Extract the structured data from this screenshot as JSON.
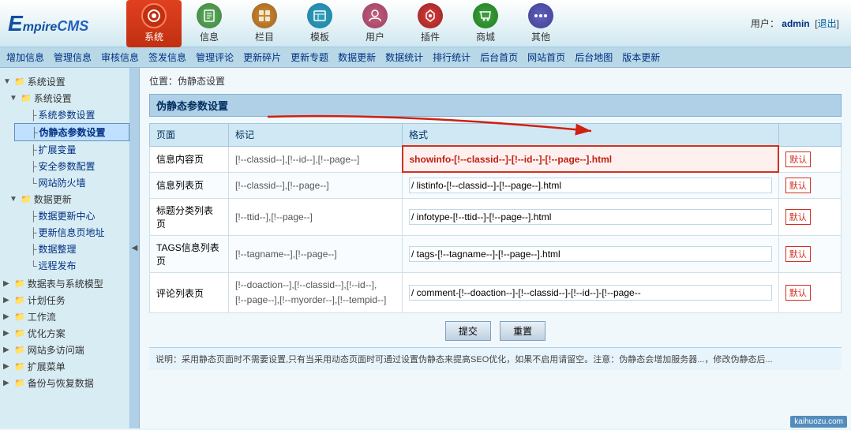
{
  "header": {
    "logo": "EmpireCMS",
    "user_label": "用户：",
    "user_name": "admin",
    "logout_label": "退出",
    "nav": [
      {
        "id": "sys",
        "label": "系统",
        "active": true
      },
      {
        "id": "info",
        "label": "信息",
        "active": false
      },
      {
        "id": "col",
        "label": "栏目",
        "active": false
      },
      {
        "id": "tpl",
        "label": "模板",
        "active": false
      },
      {
        "id": "user",
        "label": "用户",
        "active": false
      },
      {
        "id": "plugin",
        "label": "插件",
        "active": false
      },
      {
        "id": "shop",
        "label": "商城",
        "active": false
      },
      {
        "id": "other",
        "label": "其他",
        "active": false
      }
    ]
  },
  "toolbar": {
    "items": [
      "增加信息",
      "管理信息",
      "审核信息",
      "签发信息",
      "管理评论",
      "更新碎片",
      "更新专题",
      "数据更新",
      "数据统计",
      "排行统计",
      "后台首页",
      "网站首页",
      "后台地图",
      "版本更新"
    ]
  },
  "sidebar": {
    "title": "系统设置",
    "tree": [
      {
        "label": "系统设置",
        "type": "group",
        "children": [
          {
            "label": "系统参数设置",
            "active": false
          },
          {
            "label": "伪静态参数设置",
            "active": true
          },
          {
            "label": "扩展变量",
            "active": false
          },
          {
            "label": "安全参数配置",
            "active": false
          },
          {
            "label": "网站防火墙",
            "active": false
          }
        ]
      },
      {
        "label": "数据更新",
        "type": "group",
        "children": [
          {
            "label": "数据更新中心",
            "active": false
          },
          {
            "label": "更新信息页地址",
            "active": false
          },
          {
            "label": "数据整理",
            "active": false
          },
          {
            "label": "远程发布",
            "active": false
          }
        ]
      },
      {
        "label": "数据表与系统模型",
        "type": "group",
        "children": []
      },
      {
        "label": "计划任务",
        "type": "group",
        "children": []
      },
      {
        "label": "工作流",
        "type": "group",
        "children": []
      },
      {
        "label": "优化方案",
        "type": "group",
        "children": []
      },
      {
        "label": "网站多访问端",
        "type": "group",
        "children": []
      },
      {
        "label": "扩展菜单",
        "type": "group",
        "children": []
      },
      {
        "label": "备份与恢复数据",
        "type": "group",
        "children": []
      }
    ]
  },
  "content": {
    "breadcrumb": "位置：伪静态设置",
    "section_title": "伪静态参数设置",
    "table_headers": [
      "页面",
      "标记",
      "格式"
    ],
    "rows": [
      {
        "page": "信息内容页",
        "mark": "[!--classid--],[!--id--],[!--page--]",
        "format": "/ showinfo-[!--classid--]-[!--id--]-[!--page--].html",
        "highlighted": true,
        "default_btn": "默认"
      },
      {
        "page": "信息列表页",
        "mark": "[!--classid--],[!--page--]",
        "format": "/ listinfo-[!--classid--]-[!--page--].html",
        "highlighted": false,
        "default_btn": "默认"
      },
      {
        "page": "标题分类列表页",
        "mark": "[!--ttid--],[!--page--]",
        "format": "/ infotype-[!--ttid--]-[!--page--].html",
        "highlighted": false,
        "default_btn": "默认"
      },
      {
        "page": "TAGS信息列表页",
        "mark": "[!--tagname--],[!--page--]",
        "format": "/ tags-[!--tagname--]-[!--page--].html",
        "highlighted": false,
        "default_btn": "默认"
      },
      {
        "page": "评论列表页",
        "mark": "[!--doaction--],[!--classid--],[!--id--],\n[!--page--],[!--myorder--],[!--tempid--]",
        "format": "/ comment-[!--doaction--]-[!--classid--]-[!--id--]-[!--page--",
        "highlighted": false,
        "default_btn": "默认"
      }
    ],
    "submit_label": "提交",
    "reset_label": "重置",
    "note": "说明：采用静态页面时不需要设置,只有当采用动态页面时可通过设置伪静态来提高SEO优化，如果不启用请留空。注意：伪静态会增加服务器...，修改伪静态后..."
  },
  "watermark": "kaihuozu.com"
}
